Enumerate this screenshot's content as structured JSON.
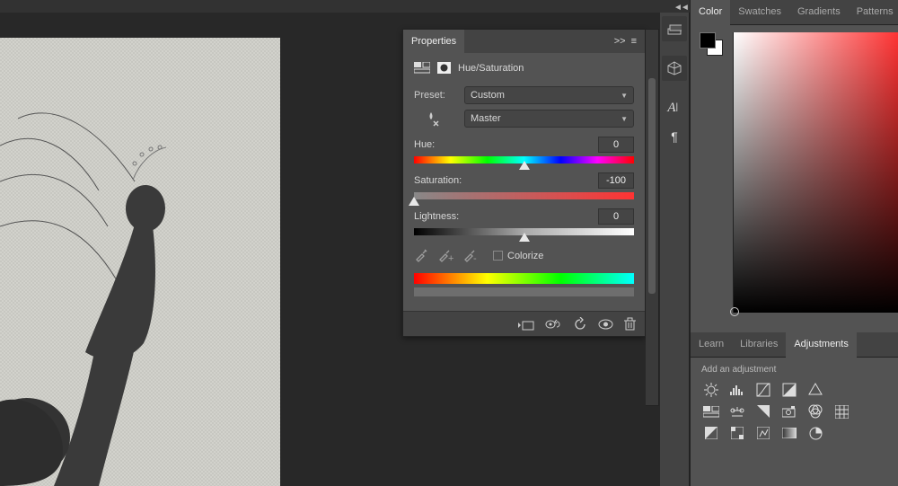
{
  "collapse_glyph": "◄◄",
  "mid_dock_icons": [
    "layers-icon",
    "3d-icon",
    "text-icon",
    "paragraph-icon"
  ],
  "right_tabs": {
    "color": "Color",
    "swatches": "Swatches",
    "gradients": "Gradients",
    "patterns": "Patterns"
  },
  "color_picker": {
    "foreground": "#000000",
    "background": "#ffffff",
    "field_hue": "#ff3333"
  },
  "bottom_tabs": {
    "learn": "Learn",
    "libraries": "Libraries",
    "adjustments": "Adjustments"
  },
  "adjustments_header": "Add an adjustment",
  "panel": {
    "title": "Properties",
    "tail_glyphs": ">>",
    "type_label": "Hue/Saturation",
    "preset_label": "Preset:",
    "preset_value": "Custom",
    "channel_value": "Master",
    "sliders": {
      "hue": {
        "label": "Hue:",
        "value": "0",
        "pos": 50
      },
      "sat": {
        "label": "Saturation:",
        "value": "-100",
        "pos": 0
      },
      "light": {
        "label": "Lightness:",
        "value": "0",
        "pos": 50
      }
    },
    "colorize_label": "Colorize",
    "colorize_checked": false,
    "footer_icons": [
      "clip-icon",
      "view-previous-icon",
      "reset-icon",
      "visibility-icon",
      "trash-icon"
    ]
  }
}
